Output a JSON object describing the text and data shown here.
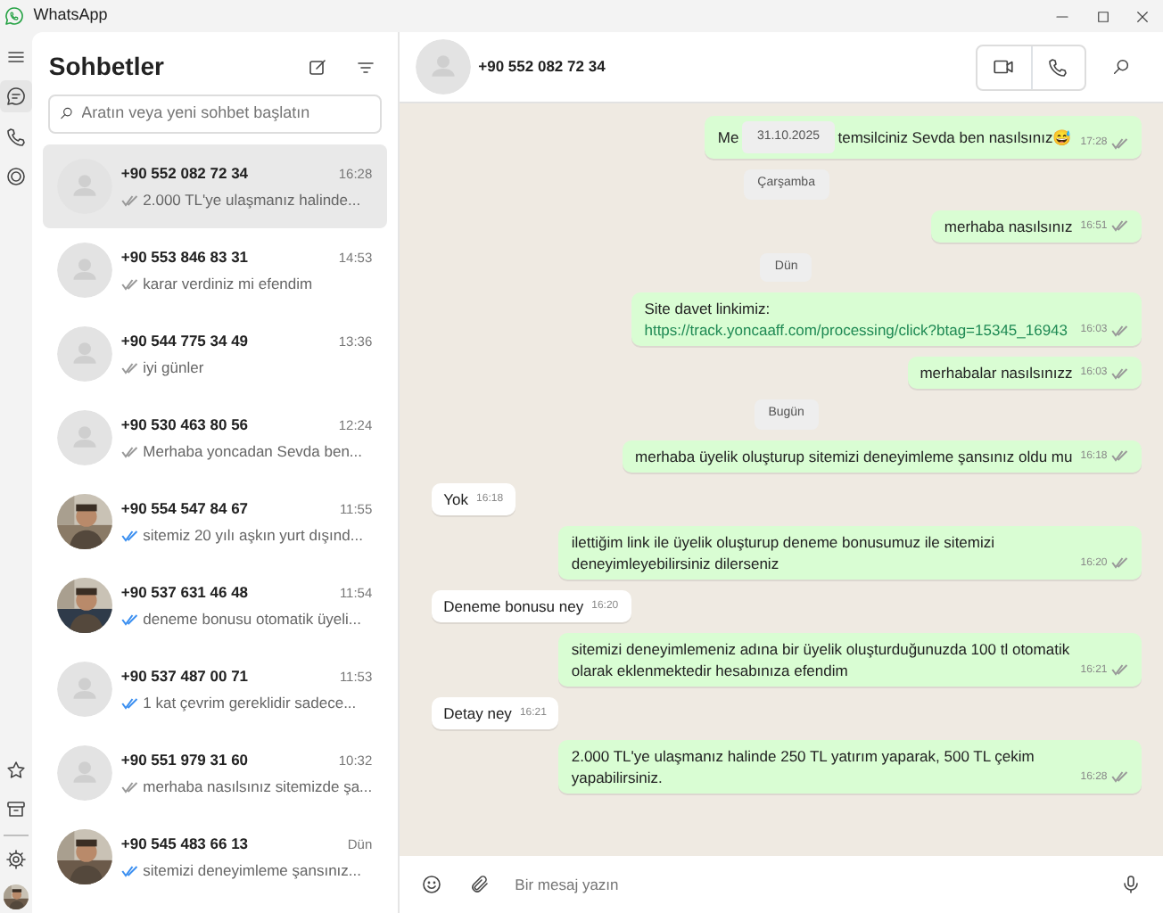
{
  "window": {
    "title": "WhatsApp"
  },
  "rail": {
    "items": [
      {
        "kind": "menu",
        "selected": false
      },
      {
        "kind": "chats",
        "selected": true
      },
      {
        "kind": "calls",
        "selected": false
      },
      {
        "kind": "status",
        "selected": false
      }
    ],
    "bottom": [
      {
        "kind": "star"
      },
      {
        "kind": "archive"
      },
      {
        "kind": "settings"
      },
      {
        "kind": "profile"
      }
    ]
  },
  "sidebar": {
    "title": "Sohbetler",
    "search": {
      "placeholder": "Aratın veya yeni sohbet başlatın"
    },
    "chats": [
      {
        "name": "+90 552 082 72 34",
        "time": "16:28",
        "preview": "2.000 TL'ye ulaşmanız halinde...",
        "read": false,
        "has_photo": false,
        "selected": true
      },
      {
        "name": "+90 553 846 83 31",
        "time": "14:53",
        "preview": "karar verdiniz mi efendim",
        "read": false,
        "has_photo": false,
        "selected": false
      },
      {
        "name": "+90 544 775 34 49",
        "time": "13:36",
        "preview": "iyi günler",
        "read": false,
        "has_photo": false,
        "selected": false
      },
      {
        "name": "+90 530 463 80 56",
        "time": "12:24",
        "preview": "Merhaba yoncadan Sevda ben...",
        "read": false,
        "has_photo": false,
        "selected": false
      },
      {
        "name": "+90 554 547 84 67",
        "time": "11:55",
        "preview": "sitemiz 20 yılı aşkın yurt dışınd...",
        "read": true,
        "has_photo": true,
        "selected": false
      },
      {
        "name": "+90 537 631 46 48",
        "time": "11:54",
        "preview": "deneme bonusu otomatik üyeli...",
        "read": true,
        "has_photo": true,
        "selected": false
      },
      {
        "name": "+90 537 487 00 71",
        "time": "11:53",
        "preview": "1 kat çevrim gereklidir sadece...",
        "read": true,
        "has_photo": false,
        "selected": false
      },
      {
        "name": "+90 551 979 31 60",
        "time": "10:32",
        "preview": "merhaba nasılsınız sitemizde şa...",
        "read": false,
        "has_photo": false,
        "selected": false
      },
      {
        "name": "+90 545 483 66 13",
        "time": "Dün",
        "preview": "sitemizi deneyimleme şansınız...",
        "read": true,
        "has_photo": true,
        "selected": false
      }
    ]
  },
  "chat": {
    "name": "+90 552 082 72 34",
    "messages": [
      {
        "kind": "out",
        "parts": [
          "Me",
          "temsilciniz Sevda ben nasılsınız😅"
        ],
        "floating_date": "31.10.2025",
        "time": "17:28"
      },
      {
        "kind": "date",
        "text": "Çarşamba"
      },
      {
        "kind": "out",
        "text": "merhaba nasılsınız",
        "time": "16:51"
      },
      {
        "kind": "date",
        "text": "Dün"
      },
      {
        "kind": "out",
        "text": "Site davet linkimiz: ",
        "link": "https://track.yoncaaff.com/processing/click?btag=15345_16943",
        "time": "16:03"
      },
      {
        "kind": "out",
        "text": "merhabalar nasılsınızz",
        "time": "16:03"
      },
      {
        "kind": "date",
        "text": "Bugün"
      },
      {
        "kind": "out",
        "text": "merhaba üyelik oluşturup sitemizi deneyimleme şansınız oldu mu",
        "time": "16:18"
      },
      {
        "kind": "in",
        "text": "Yok",
        "time": "16:18"
      },
      {
        "kind": "out",
        "text": "ilettiğim link ile üyelik oluşturup deneme bonusumuz ile sitemizi deneyimleyebilirsiniz dilerseniz",
        "time": "16:20"
      },
      {
        "kind": "in",
        "text": "Deneme bonusu ney",
        "time": "16:20"
      },
      {
        "kind": "out",
        "text": "sitemizi deneyimlemeniz adına bir üyelik oluşturduğunuzda 100 tl otomatik olarak eklenmektedir hesabınıza efendim",
        "time": "16:21"
      },
      {
        "kind": "in",
        "text": "Detay ney",
        "time": "16:21"
      },
      {
        "kind": "out",
        "text": "2.000 TL'ye ulaşmanız halinde 250 TL yatırım yaparak,  500 TL çekim yapabilirsiniz.",
        "time": "16:28"
      }
    ]
  },
  "composer": {
    "placeholder": "Bir mesaj yazın"
  }
}
